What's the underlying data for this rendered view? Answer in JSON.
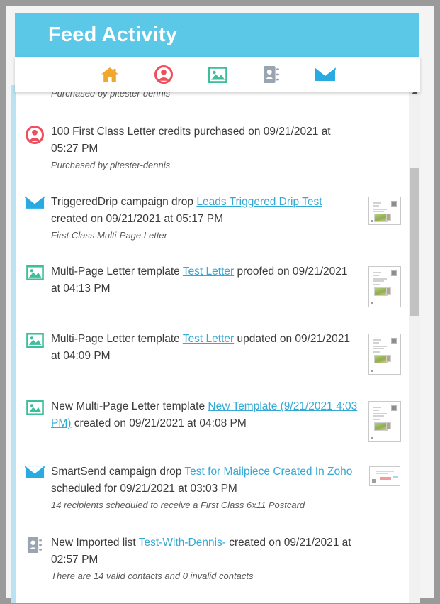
{
  "header": {
    "title": "Feed Activity",
    "background_color": "#5bc8e8"
  },
  "nav": {
    "items": [
      {
        "name": "home-icon",
        "label": "Home",
        "color": "#f0a730"
      },
      {
        "name": "user-icon",
        "label": "Account",
        "color": "#ef4e5e"
      },
      {
        "name": "image-icon",
        "label": "Templates",
        "color": "#3cbf9a"
      },
      {
        "name": "address-book-icon",
        "label": "Contacts",
        "color": "#9aa5b1"
      },
      {
        "name": "envelope-icon",
        "label": "Campaigns",
        "color": "#29abe2"
      }
    ]
  },
  "feed": {
    "partial_top_item": {
      "subtext": "Purchased by pltester-dennis"
    },
    "items": [
      {
        "icon": "user-icon",
        "icon_color": "#ef4e5e",
        "segments": [
          {
            "type": "text",
            "value": "100 First Class Letter credits purchased on 09/21/2021 at 05:27 PM"
          }
        ],
        "subtext": "Purchased by pltester-dennis",
        "thumbnail": null
      },
      {
        "icon": "envelope-icon",
        "icon_color": "#29abe2",
        "segments": [
          {
            "type": "text",
            "value": "TriggeredDrip campaign drop "
          },
          {
            "type": "link",
            "value": "Leads Triggered Drip Test"
          },
          {
            "type": "text",
            "value": " created on 09/21/2021 at 05:17 PM"
          }
        ],
        "subtext": "First Class Multi-Page Letter",
        "thumbnail": "letter"
      },
      {
        "icon": "image-icon",
        "icon_color": "#3cbf9a",
        "segments": [
          {
            "type": "text",
            "value": "Multi-Page Letter template "
          },
          {
            "type": "link",
            "value": "Test Letter"
          },
          {
            "type": "text",
            "value": " proofed on 09/21/2021 at 04:13 PM"
          }
        ],
        "subtext": null,
        "thumbnail": "letter-tall"
      },
      {
        "icon": "image-icon",
        "icon_color": "#3cbf9a",
        "segments": [
          {
            "type": "text",
            "value": "Multi-Page Letter template "
          },
          {
            "type": "link",
            "value": "Test Letter"
          },
          {
            "type": "text",
            "value": " updated on 09/21/2021 at 04:09 PM"
          }
        ],
        "subtext": null,
        "thumbnail": "letter-tall"
      },
      {
        "icon": "image-icon",
        "icon_color": "#3cbf9a",
        "segments": [
          {
            "type": "text",
            "value": "New Multi-Page Letter template "
          },
          {
            "type": "link",
            "value": "New Template (9/21/2021 4:03 PM)"
          },
          {
            "type": "text",
            "value": " created on 09/21/2021 at 04:08 PM"
          }
        ],
        "subtext": null,
        "thumbnail": "letter-tall"
      },
      {
        "icon": "envelope-icon",
        "icon_color": "#29abe2",
        "segments": [
          {
            "type": "text",
            "value": "SmartSend campaign drop "
          },
          {
            "type": "link",
            "value": "Test for Mailpiece Created In Zoho"
          },
          {
            "type": "text",
            "value": " scheduled for 09/21/2021 at 03:03 PM"
          }
        ],
        "subtext": "14 recipients scheduled to receive a First Class 6x11 Postcard",
        "thumbnail": "postcard"
      },
      {
        "icon": "address-book-icon",
        "icon_color": "#9aa5b1",
        "segments": [
          {
            "type": "text",
            "value": "New Imported list "
          },
          {
            "type": "link",
            "value": "Test-With-Dennis-"
          },
          {
            "type": "text",
            "value": " created on 09/21/2021 at 02:57 PM"
          }
        ],
        "subtext": "There are 14 valid contacts and 0 invalid contacts",
        "thumbnail": null
      }
    ]
  },
  "scrollbar": {
    "up_arrow": "▲",
    "track_color": "#f1f1f1",
    "thumb_color": "#c2c2c2"
  },
  "colors": {
    "link": "#35a9d4",
    "accent": "#5bc8e8",
    "left_rail": "#b9e3f2"
  }
}
